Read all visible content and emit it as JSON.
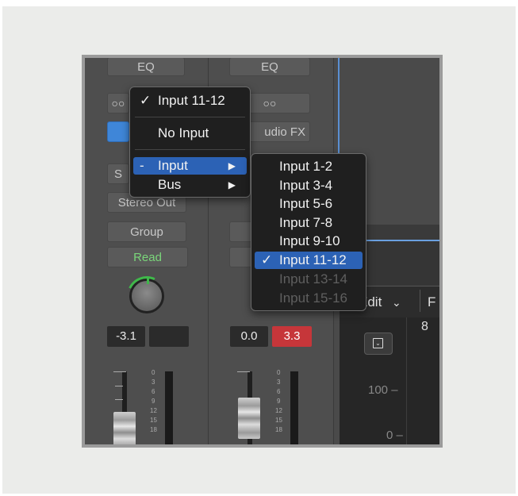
{
  "strip1": {
    "eq": "EQ",
    "link": "○○",
    "s_label": "S",
    "output": "Stereo Out",
    "group": "Group",
    "automation": "Read",
    "pan_value": "-3.1",
    "peak_value": ""
  },
  "strip2": {
    "eq": "EQ",
    "link": "○○",
    "audio_fx": "udio FX",
    "pan_value": "0.0",
    "peak_value": "3.3"
  },
  "fader_scale": [
    "0",
    "3",
    "6",
    "9",
    "12",
    "15",
    "18"
  ],
  "right_panel": {
    "edit_label": "Edit",
    "edit_chevron": "⌄",
    "f_label": "F",
    "bar_number": "8",
    "dropdown_icon": "⌄",
    "value_100": "100 –",
    "value_0": "0 –"
  },
  "input_menu": {
    "items": [
      {
        "check": "✓",
        "label": "Input 11-12",
        "arrow": ""
      },
      {
        "check": "",
        "label": "No Input",
        "arrow": ""
      },
      {
        "check": "-",
        "label": "Input",
        "arrow": "▶"
      },
      {
        "check": "",
        "label": "Bus",
        "arrow": "▶"
      }
    ]
  },
  "input_submenu": {
    "items": [
      {
        "check": "",
        "label": "Input 1-2"
      },
      {
        "check": "",
        "label": "Input 3-4"
      },
      {
        "check": "",
        "label": "Input 5-6"
      },
      {
        "check": "",
        "label": "Input 7-8"
      },
      {
        "check": "",
        "label": "Input 9-10"
      },
      {
        "check": "✓",
        "label": "Input 11-12"
      },
      {
        "check": "",
        "label": "Input 13-14"
      },
      {
        "check": "",
        "label": "Input 15-16"
      }
    ]
  },
  "colors": {
    "selection": "#2c62b5",
    "read_green": "#7ad67a",
    "peak_red": "#c6363a",
    "blue_button": "#3f86d8",
    "knob_ring": "#3fb84a"
  }
}
